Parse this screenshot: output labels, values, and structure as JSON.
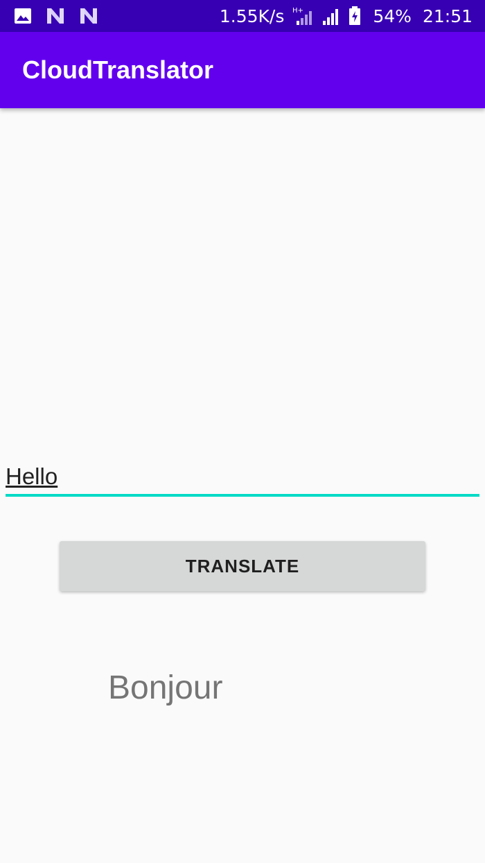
{
  "status_bar": {
    "icons": [
      "image-icon",
      "n-notification-icon",
      "n-notification-icon",
      "hplus-network-icon",
      "signal-icon",
      "battery-charging-icon"
    ],
    "net_speed": "1.55K/s",
    "network_type": "H+",
    "battery_percent": "54%",
    "time": "21:51"
  },
  "app_bar": {
    "title": "CloudTranslator",
    "color": "#6200ee",
    "status_color": "#3700b3"
  },
  "main": {
    "input_value": "Hello",
    "input_underline_color": "#03dac6",
    "translate_button_label": "TRANSLATE",
    "output_text": "Bonjour"
  }
}
